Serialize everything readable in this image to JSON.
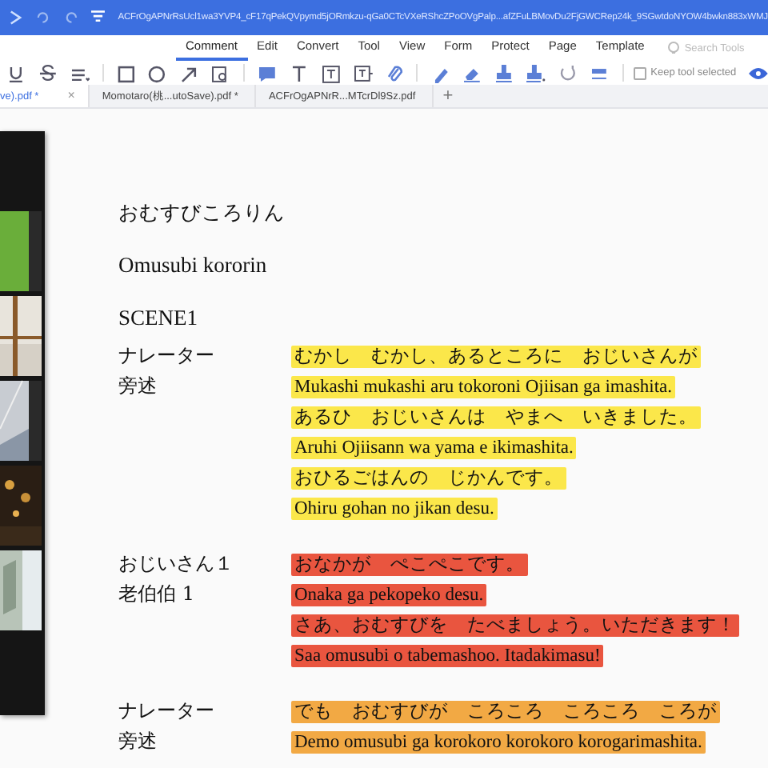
{
  "title_bar": {
    "url": "ACFrOgAPNrRsUcl1wa3YVP4_cF17qPekQVpymd5jORmkzu-qGa0CTcVXeRShcZPoOVgPalp...afZFuLBMovDu2FjGWCRep24k_9SGwtdoNYOW4bwkn883xWMJ"
  },
  "menu_tabs": [
    {
      "label": "Comment",
      "selected": true
    },
    {
      "label": "Edit",
      "selected": false
    },
    {
      "label": "Convert",
      "selected": false
    },
    {
      "label": "Tool",
      "selected": false
    },
    {
      "label": "View",
      "selected": false
    },
    {
      "label": "Form",
      "selected": false
    },
    {
      "label": "Protect",
      "selected": false
    },
    {
      "label": "Page",
      "selected": false
    },
    {
      "label": "Template",
      "selected": false
    }
  ],
  "search": {
    "placeholder": "Search Tools"
  },
  "toolbar": {
    "keep_tool": {
      "label": "Keep tool selected",
      "checked": false
    }
  },
  "doc_tabs": [
    {
      "label": "ve).pdf *",
      "selected": true,
      "close": "×"
    },
    {
      "label": "Momotaro(桃...utoSave).pdf *",
      "selected": false
    },
    {
      "label": "ACFrOgAPNrR...MTcrDl9Sz.pdf",
      "selected": false
    }
  ],
  "new_tab": "+",
  "document": {
    "title": "おむすびころりん",
    "romaji_title": "Omusubi kororin",
    "scene": "SCENE1",
    "blocks": [
      {
        "speaker": "ナレーター",
        "speaker_zh": "旁述",
        "color": "#fbe74a",
        "lines": [
          "むかし　むかし、あるところに　おじいさんが",
          "Mukashi mukashi aru tokoroni Ojiisan ga imashita.",
          "あるひ　おじいさんは　やまへ　いきました。",
          "Aruhi Ojiisann wa yama e ikimashita.",
          "おひるごはんの　じかんです。",
          "Ohiru gohan no jikan desu."
        ]
      },
      {
        "speaker": "おじいさん１",
        "speaker_zh": "老伯伯 1",
        "color": "#e9553f",
        "lines": [
          "おなかが　ぺこぺこです。",
          "Onaka ga pekopeko desu.",
          "さあ、おむすびを　たべましょう。いただきます！",
          "Saa omusubi o tabemashoo. Itadakimasu!"
        ]
      },
      {
        "speaker": "ナレーター",
        "speaker_zh": "旁述",
        "color": "#f2a944",
        "lines": [
          "でも　おむすびが　ころころ　ころころ　ころが",
          "Demo omusubi ga korokoro korokoro korogarimashita."
        ]
      }
    ]
  }
}
